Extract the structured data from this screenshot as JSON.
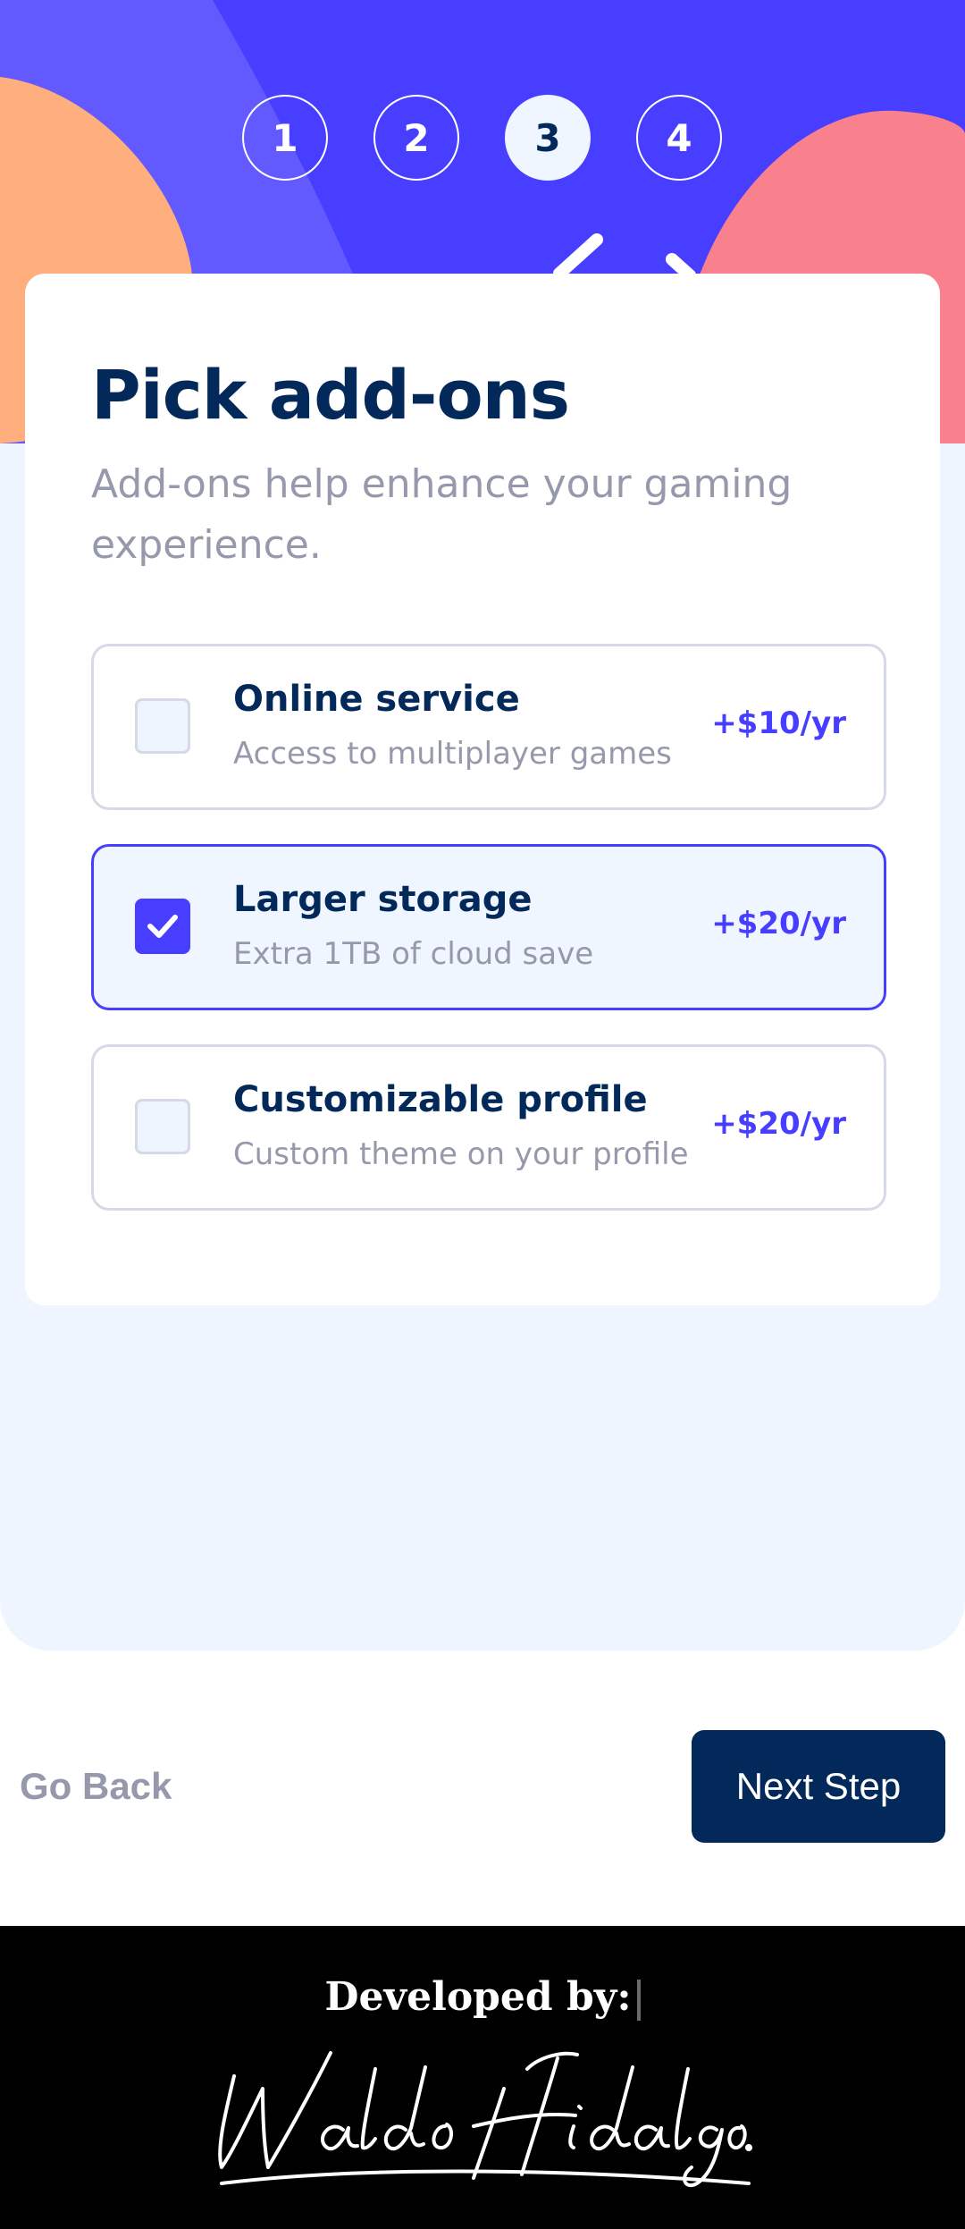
{
  "steps": [
    "1",
    "2",
    "3",
    "4"
  ],
  "active_step": 3,
  "form": {
    "title": "Pick add-ons",
    "subtitle": "Add-ons help enhance your gaming experience."
  },
  "addons": [
    {
      "name": "Online service",
      "description": "Access to multiplayer games",
      "price": "+$10/yr",
      "checked": false
    },
    {
      "name": "Larger storage",
      "description": "Extra 1TB of cloud save",
      "price": "+$20/yr",
      "checked": true
    },
    {
      "name": "Customizable profile",
      "description": "Custom theme on your profile",
      "price": "+$20/yr",
      "checked": false
    }
  ],
  "nav": {
    "back_label": "Go Back",
    "next_label": "Next Step"
  },
  "footer": {
    "developed_by": "Developed by:",
    "signature": "Waldo Hidalgo."
  },
  "colors": {
    "marine_blue": "#02295a",
    "purplish_blue": "#483eff",
    "cool_gray": "#9699ab",
    "light_gray": "#d6d9e6",
    "magnolia": "#f0f6ff"
  }
}
